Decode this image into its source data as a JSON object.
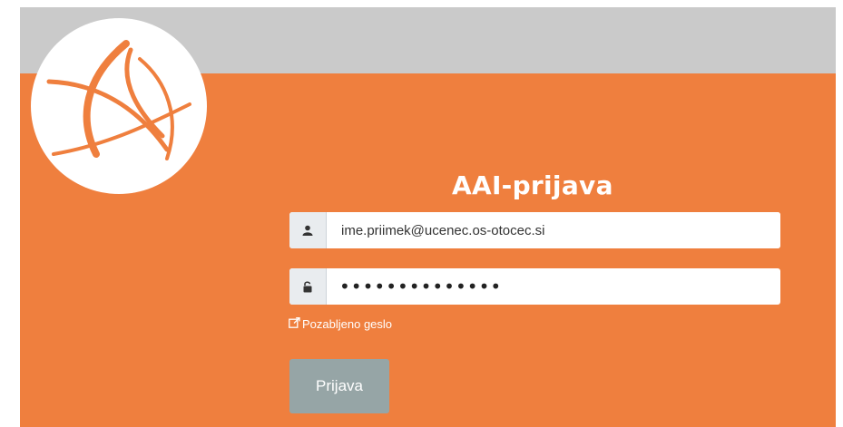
{
  "header": {
    "title": "AAI-prijava"
  },
  "login_form": {
    "username_value": "ime.priimek@ucenec.os-otocec.si",
    "password_masked": "••••••••••••••",
    "forgot_password_label": "Pozabljeno geslo",
    "submit_label": "Prijava"
  },
  "icons": {
    "username": "user-icon",
    "password": "unlock-icon",
    "forgot": "external-link-icon",
    "logo": "logo-icon"
  },
  "colors": {
    "accent": "#ef7f3e",
    "top_band": "#cacaca",
    "button": "#96a5a6"
  }
}
